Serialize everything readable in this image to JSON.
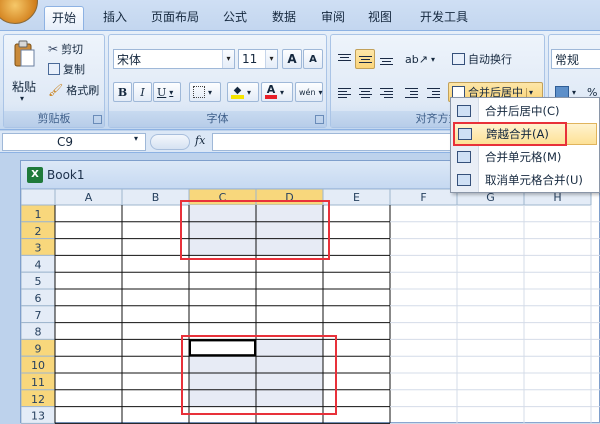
{
  "tabs": [
    {
      "label": "开始",
      "active": true
    },
    {
      "label": "插入"
    },
    {
      "label": "页面布局"
    },
    {
      "label": "公式"
    },
    {
      "label": "数据"
    },
    {
      "label": "审阅"
    },
    {
      "label": "视图"
    },
    {
      "label": "开发工具"
    }
  ],
  "clipboard": {
    "paste": "粘贴",
    "cut": "剪切",
    "copy": "复制",
    "format_painter": "格式刷",
    "group_label": "剪贴板"
  },
  "font": {
    "name": "宋体",
    "size": "11",
    "grow_label": "A",
    "shrink_label": "A",
    "bold": "B",
    "italic": "I",
    "underline": "U",
    "font_color_letter": "A",
    "phonetic": "wén",
    "group_label": "字体"
  },
  "alignment": {
    "wrap_text": "自动换行",
    "merge_center": "合并后居中",
    "group_label": "对齐方式"
  },
  "number": {
    "format": "常规",
    "percent": "%"
  },
  "formula_bar": {
    "name_box": "C9",
    "fx": "fx",
    "value": ""
  },
  "workbook": {
    "title": "Book1",
    "columns": [
      "A",
      "B",
      "C",
      "D",
      "E",
      "F",
      "G",
      "H"
    ],
    "rows": [
      "1",
      "2",
      "3",
      "4",
      "5",
      "6",
      "7",
      "8",
      "9",
      "10",
      "11",
      "12",
      "13"
    ],
    "selected_columns": [
      "C",
      "D"
    ],
    "selected_rows": [
      "1",
      "2",
      "3",
      "9",
      "10",
      "11",
      "12"
    ],
    "active_cell": "C9"
  },
  "merge_menu": {
    "items": [
      {
        "label": "合并后居中(C)"
      },
      {
        "label": "跨越合并(A)",
        "highlighted": true
      },
      {
        "label": "合并单元格(M)"
      },
      {
        "label": "取消单元格合并(U)"
      }
    ]
  },
  "colors": {
    "annotation": "#e8313a",
    "selection_fill": "#e7ebf5",
    "selected_header": "#f8d77c",
    "header_bg": "#e4ecf7",
    "font_color_underline": "#e8202a",
    "fill_color_underline": "#f5e400"
  }
}
